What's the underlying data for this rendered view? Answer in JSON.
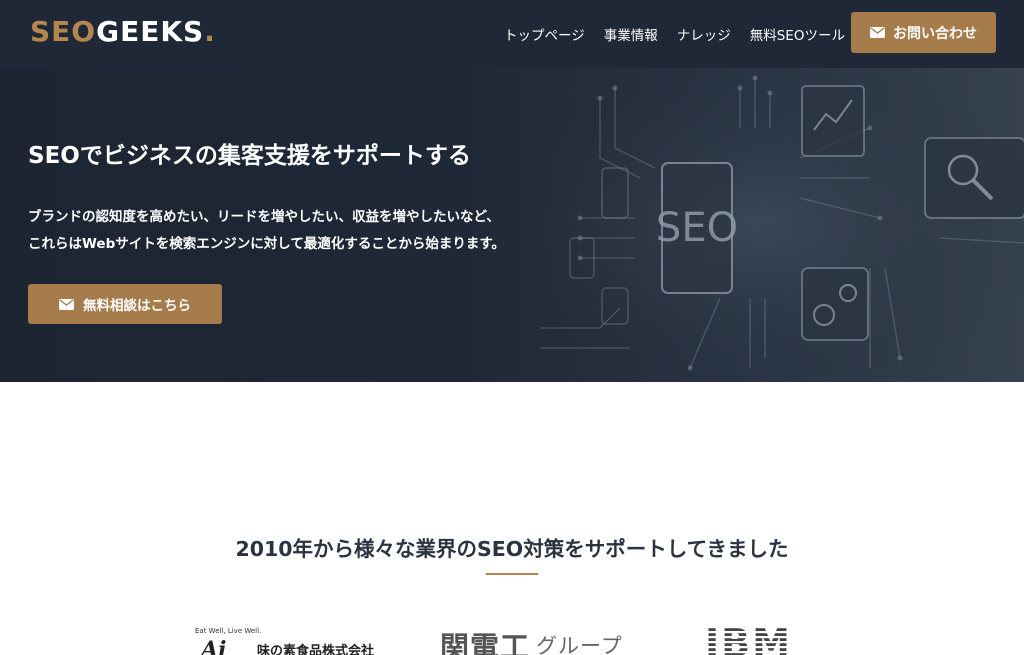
{
  "header": {
    "logo": {
      "part1": "SEO",
      "part2": "GEEKS",
      "part3": "."
    },
    "nav": [
      {
        "label": "トップページ"
      },
      {
        "label": "事業情報"
      },
      {
        "label": "ナレッジ"
      },
      {
        "label": "無料SEOツール"
      }
    ],
    "contact_label": "お問い合わせ"
  },
  "hero": {
    "title": "SEOでビジネスの集客支援をサポートする",
    "text_line1": "ブランドの認知度を高めたい、リードを増やしたい、収益を増やしたいなど、",
    "text_line2": "これらはWebサイトを検索エンジンに対して最適化することから始まります。",
    "cta_label": "無料相談はこちら",
    "art_text": "SEO"
  },
  "clients": {
    "title": "2010年から様々な業界のSEO対策をサポートしてきました",
    "logos": [
      {
        "tag": "Eat Well, Live Well.",
        "mark": "Ai",
        "name": "味の素食品株式会社"
      },
      {
        "big": "関電工",
        "small": "グループ"
      },
      {
        "name": "IBM"
      }
    ]
  },
  "colors": {
    "accent": "#a67c4b",
    "header_bg": "#1f2837",
    "hero_bg": "#1f2836"
  },
  "icons": {
    "mail": "envelope-icon"
  }
}
